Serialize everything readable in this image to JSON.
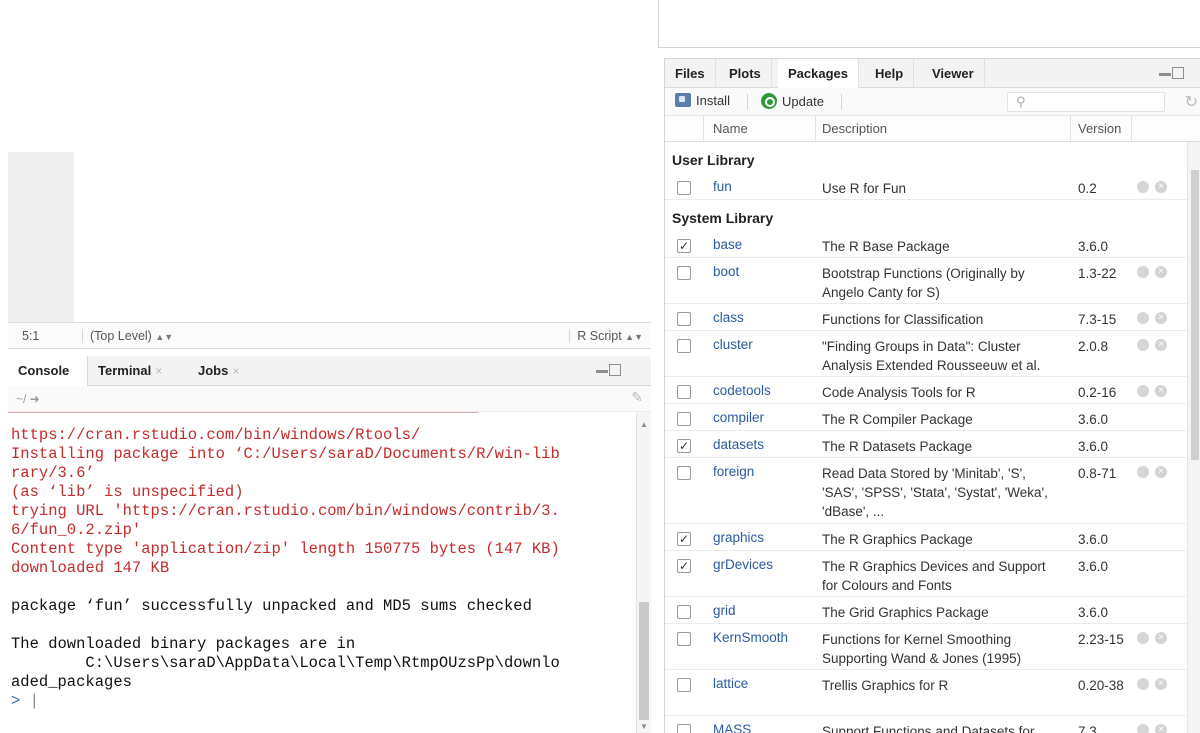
{
  "editor": {
    "cursor_position": "5:1",
    "scope": "(Top Level)",
    "file_type": "R Script"
  },
  "console": {
    "tabs": [
      {
        "label": "Console"
      },
      {
        "label": "Terminal"
      },
      {
        "label": "Jobs"
      }
    ],
    "path": "~/",
    "lines": [
      {
        "text": "https://cran.rstudio.com/bin/windows/Rtools/",
        "style": "red"
      },
      {
        "text": "Installing package into ‘C:/Users/saraD/Documents/R/win-lib",
        "style": "red"
      },
      {
        "text": "rary/3.6’",
        "style": "red"
      },
      {
        "text": "(as ‘lib’ is unspecified)",
        "style": "red"
      },
      {
        "text": "trying URL 'https://cran.rstudio.com/bin/windows/contrib/3.",
        "style": "red"
      },
      {
        "text": "6/fun_0.2.zip'",
        "style": "red"
      },
      {
        "text": "Content type 'application/zip' length 150775 bytes (147 KB)",
        "style": "red"
      },
      {
        "text": "downloaded 147 KB",
        "style": "red"
      },
      {
        "text": "",
        "style": "blank"
      },
      {
        "text": "package ‘fun’ successfully unpacked and MD5 sums checked",
        "style": "black"
      },
      {
        "text": "",
        "style": "blank"
      },
      {
        "text": "The downloaded binary packages are in",
        "style": "black"
      },
      {
        "text": "        C:\\Users\\saraD\\AppData\\Local\\Temp\\RtmpOUzsPp\\downlo",
        "style": "black"
      },
      {
        "text": "aded_packages",
        "style": "black"
      }
    ],
    "prompt": ">"
  },
  "files_pane": {
    "tabs": [
      {
        "label": "Files"
      },
      {
        "label": "Plots"
      },
      {
        "label": "Packages"
      },
      {
        "label": "Help"
      },
      {
        "label": "Viewer"
      }
    ],
    "toolbar": {
      "install_label": "Install",
      "update_label": "Update"
    },
    "columns": {
      "name": "Name",
      "description": "Description",
      "version": "Version"
    },
    "user_library_label": "User Library",
    "system_library_label": "System Library",
    "user_packages": [
      {
        "name": "fun",
        "description": "Use R for Fun",
        "version": "0.2",
        "checked": false,
        "actions": true
      }
    ],
    "system_packages": [
      {
        "name": "base",
        "description": "The R Base Package",
        "version": "3.6.0",
        "checked": true,
        "actions": false
      },
      {
        "name": "boot",
        "description": "Bootstrap Functions (Originally by Angelo Canty for S)",
        "version": "1.3-22",
        "checked": false,
        "actions": true
      },
      {
        "name": "class",
        "description": "Functions for Classification",
        "version": "7.3-15",
        "checked": false,
        "actions": true
      },
      {
        "name": "cluster",
        "description": "\"Finding Groups in Data\": Cluster Analysis Extended Rousseeuw et al.",
        "version": "2.0.8",
        "checked": false,
        "actions": true
      },
      {
        "name": "codetools",
        "description": "Code Analysis Tools for R",
        "version": "0.2-16",
        "checked": false,
        "actions": true
      },
      {
        "name": "compiler",
        "description": "The R Compiler Package",
        "version": "3.6.0",
        "checked": false,
        "actions": false
      },
      {
        "name": "datasets",
        "description": "The R Datasets Package",
        "version": "3.6.0",
        "checked": true,
        "actions": false
      },
      {
        "name": "foreign",
        "description": "Read Data Stored by 'Minitab', 'S', 'SAS', 'SPSS', 'Stata', 'Systat', 'Weka', 'dBase', ...",
        "version": "0.8-71",
        "checked": false,
        "actions": true
      },
      {
        "name": "graphics",
        "description": "The R Graphics Package",
        "version": "3.6.0",
        "checked": true,
        "actions": false
      },
      {
        "name": "grDevices",
        "description": "The R Graphics Devices and Support for Colours and Fonts",
        "version": "3.6.0",
        "checked": true,
        "actions": false
      },
      {
        "name": "grid",
        "description": "The Grid Graphics Package",
        "version": "3.6.0",
        "checked": false,
        "actions": false
      },
      {
        "name": "KernSmooth",
        "description": "Functions for Kernel Smoothing Supporting Wand & Jones (1995)",
        "version": "2.23-15",
        "checked": false,
        "actions": true
      },
      {
        "name": "lattice",
        "description": "Trellis Graphics for R",
        "version": "0.20-38",
        "checked": false,
        "actions": true
      },
      {
        "name": "MASS",
        "description": "Support Functions and Datasets for",
        "version": "7.3",
        "checked": false,
        "actions": true
      }
    ]
  }
}
